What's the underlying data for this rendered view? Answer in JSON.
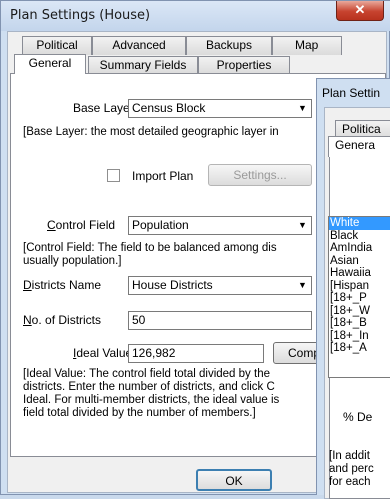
{
  "window": {
    "title": "Plan Settings (House)",
    "close_glyph": "✕"
  },
  "tabs_back": [
    "Political",
    "Advanced",
    "Backups",
    "Map"
  ],
  "tabs_front": [
    "General",
    "Summary Fields",
    "Properties"
  ],
  "general": {
    "base_layer_label": "Base Layer",
    "base_layer_value": "Census Block",
    "base_layer_note": "[Base Layer: the most detailed geographic layer in",
    "import_plan_label": "Import Plan",
    "settings_button": "Settings...",
    "control_field_label": "Control Field",
    "control_field_value": "Population",
    "control_field_note_1": "[Control Field: The field to be balanced among dis",
    "control_field_note_2": "usually population.]",
    "districts_name_label": "Districts Name",
    "districts_name_value": "House Districts",
    "num_districts_label": "No. of Districts",
    "num_districts_value": "50",
    "ideal_value_label": "Ideal Value",
    "ideal_value_value": "126,982",
    "compute_button": "Comput",
    "ideal_note_1": "[Ideal Value: The control field total divided by the",
    "ideal_note_2": "districts. Enter the number of districts, and click C",
    "ideal_note_3": "Ideal. For multi-member districts, the ideal value is",
    "ideal_note_4": "field total divided by the number of members.]"
  },
  "ok_button": "OK",
  "second_window": {
    "title": "Plan Settin",
    "tab_political": "Politica",
    "tab_general": "Genera",
    "list_items": [
      "White",
      "Black",
      "AmIndia",
      "Asian",
      "Hawaiia",
      "[Hispan",
      "[18+_P",
      "[18+_W",
      "[18+_B",
      "[18+_In",
      "[18+_A"
    ],
    "pct_label": "% De",
    "note_1": "[In addit",
    "note_2": "and perc",
    "note_3": "for each"
  }
}
